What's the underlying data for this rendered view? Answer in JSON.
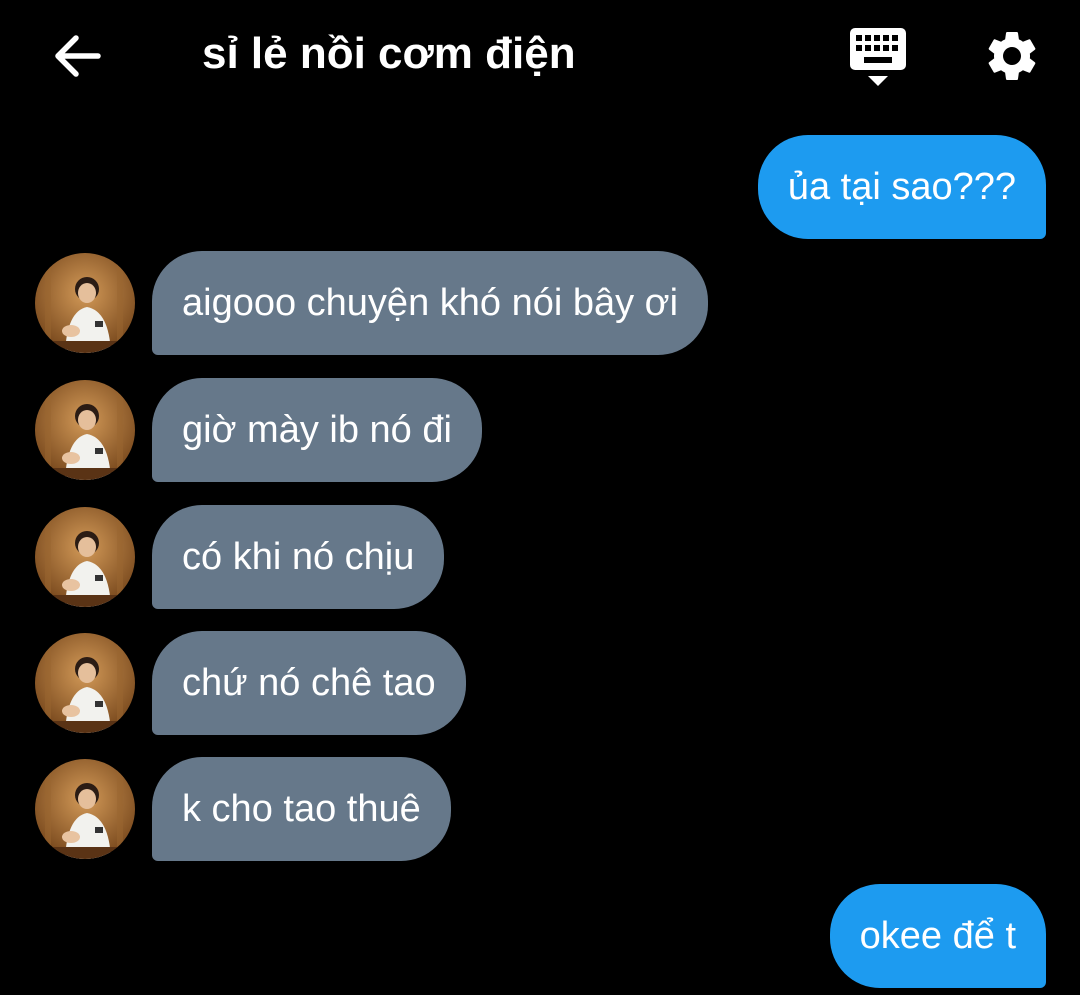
{
  "header": {
    "title": "sỉ lẻ nồi cơm điện",
    "back_icon": "arrow-left-icon",
    "keyboard_icon": "keyboard-hide-icon",
    "settings_icon": "gear-icon"
  },
  "colors": {
    "background": "#000000",
    "outgoing_bubble": "#1d9bf0",
    "incoming_bubble": "#66788a",
    "text": "#ffffff"
  },
  "messages": [
    {
      "direction": "outgoing",
      "text": "ủa tại sao???"
    },
    {
      "direction": "incoming",
      "text": "aigooo chuyện khó nói bây ơi"
    },
    {
      "direction": "incoming",
      "text": "giờ mày ib nó đi"
    },
    {
      "direction": "incoming",
      "text": "có khi nó chịu"
    },
    {
      "direction": "incoming",
      "text": "chứ nó chê tao"
    },
    {
      "direction": "incoming",
      "text": "k cho tao thuê"
    },
    {
      "direction": "outgoing",
      "text": "okee để t"
    }
  ]
}
